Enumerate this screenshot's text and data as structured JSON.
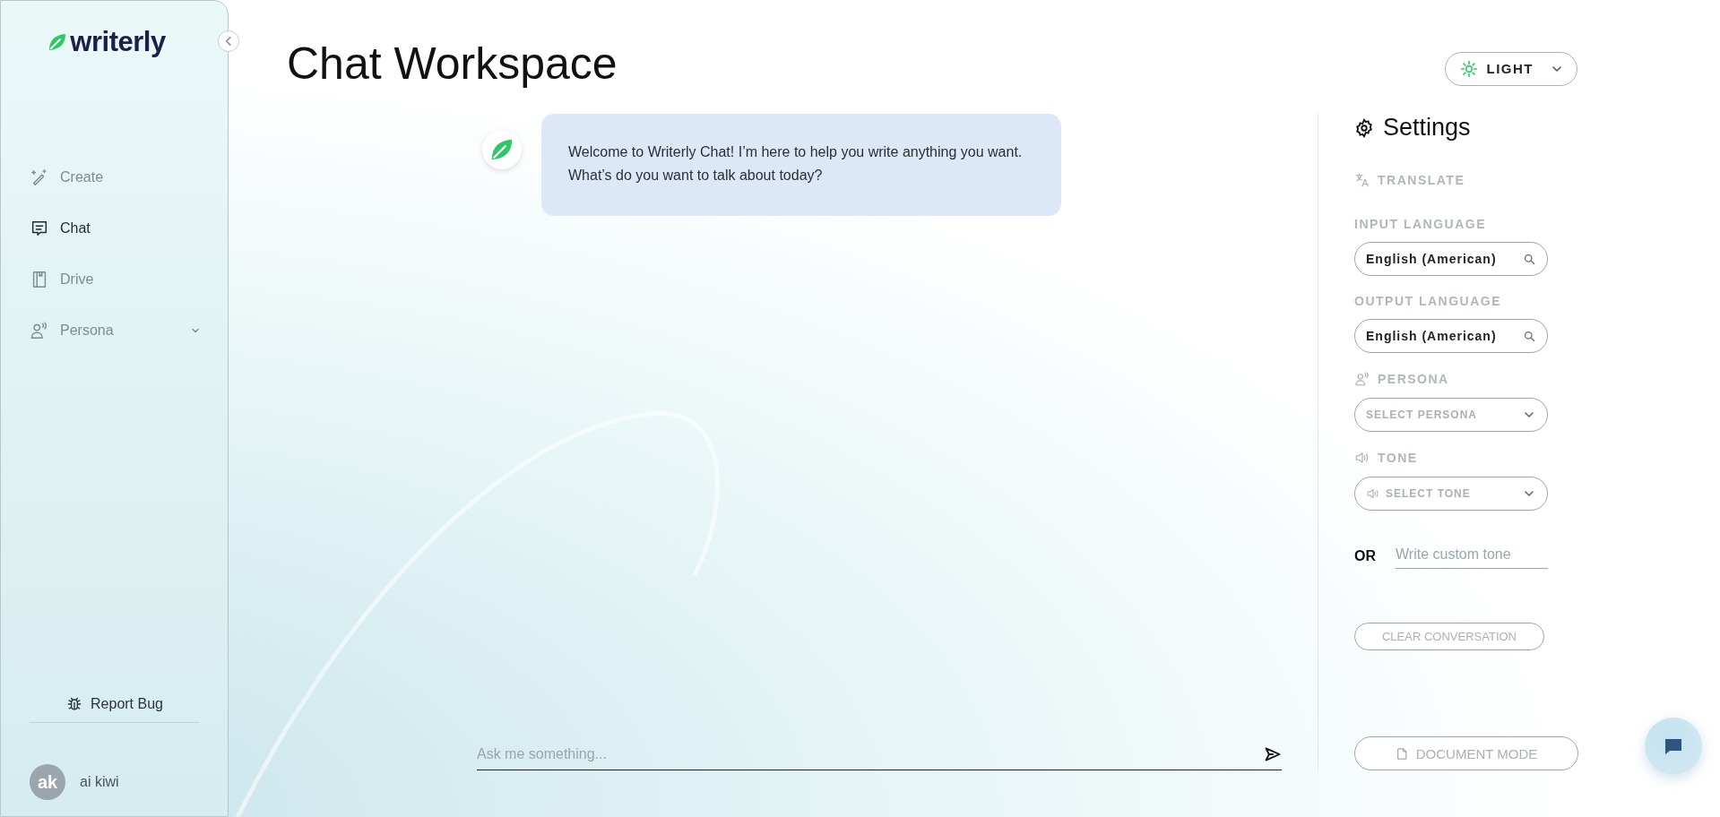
{
  "sidebar": {
    "logo": "writerly",
    "nav_items": [
      {
        "kind": "create",
        "label": "Create",
        "selected": false,
        "has_submenu": false
      },
      {
        "kind": "chat",
        "label": "Chat",
        "selected": true,
        "has_submenu": false
      },
      {
        "kind": "drive",
        "label": "Drive",
        "selected": false,
        "has_submenu": false
      },
      {
        "kind": "persona",
        "label": "Persona",
        "selected": false,
        "has_submenu": true
      }
    ],
    "report_bug": "Report Bug",
    "user": {
      "initials": "ak",
      "name": "ai kiwi"
    }
  },
  "header": {
    "title": "Chat Workspace",
    "theme_button": "LIGHT"
  },
  "chat": {
    "messages": [
      {
        "text": "Welcome to Writerly Chat! I’m here to help you write anything you want. What’s do you want to talk about today?"
      }
    ],
    "input": {
      "placeholder": "Ask me something..."
    }
  },
  "settings": {
    "title": "Settings",
    "translate_heading": "TRANSLATE",
    "input_language": {
      "label": "INPUT LANGUAGE",
      "value": "English (American)"
    },
    "output_language": {
      "label": "OUTPUT LANGUAGE",
      "value": "English (American)"
    },
    "persona": {
      "label": "PERSONA",
      "placeholder": "SELECT PERSONA"
    },
    "tone": {
      "label": "TONE",
      "placeholder": "SELECT TONE"
    },
    "or_label": "OR",
    "custom_tone": {
      "placeholder": "Write custom tone"
    },
    "clear_button": "CLEAR CONVERSATION",
    "document_mode_button": "DOCUMENT MODE"
  }
}
